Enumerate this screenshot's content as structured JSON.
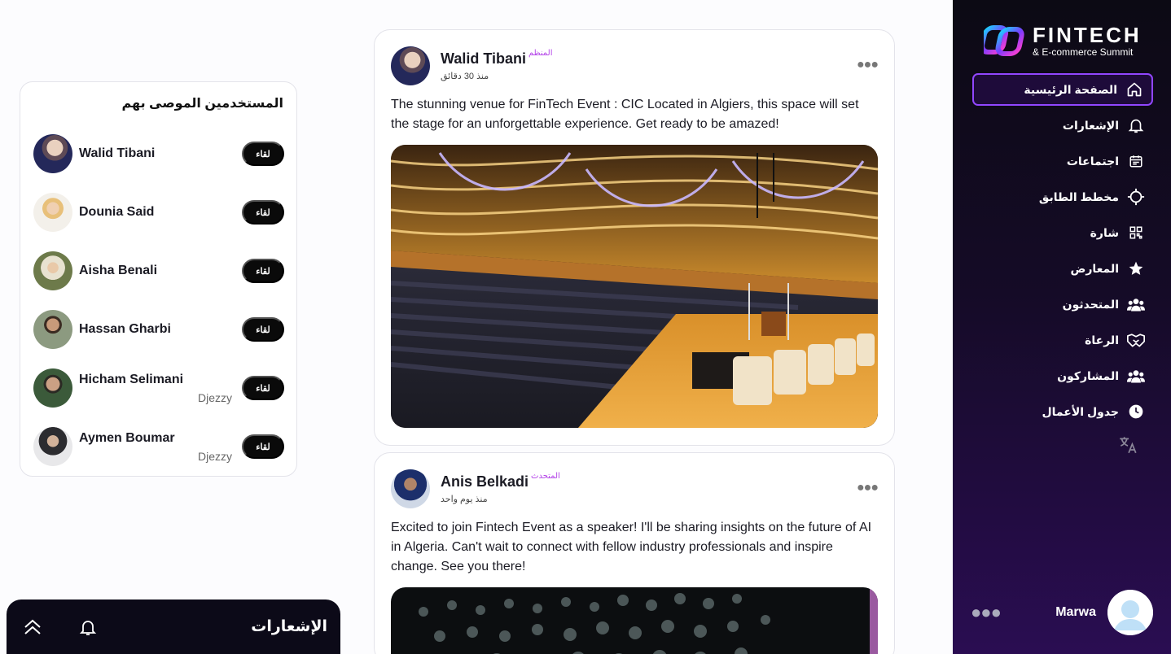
{
  "sidebar": {
    "logo": {
      "title": "FINTECH",
      "subtitle": "& E-commerce Summit"
    },
    "items": [
      {
        "label": "الصفحة الرئيسية",
        "icon": "home-icon",
        "active": true
      },
      {
        "label": "الإشعارات",
        "icon": "bell-icon"
      },
      {
        "label": "اجتماعات",
        "icon": "calendar-icon"
      },
      {
        "label": "مخطط الطابق",
        "icon": "crosshair-icon"
      },
      {
        "label": "شارة",
        "icon": "qr-code-icon"
      },
      {
        "label": "المعارض",
        "icon": "star-icon"
      },
      {
        "label": "المتحدثون",
        "icon": "users-icon"
      },
      {
        "label": "الرعاة",
        "icon": "handshake-icon"
      },
      {
        "label": "المشاركون",
        "icon": "users-icon"
      },
      {
        "label": "جدول الأعمال",
        "icon": "clock-icon"
      }
    ],
    "user": {
      "name": "Marwa"
    }
  },
  "recommended": {
    "title": "المستخدمين الموصى بهم",
    "button_label": "لقاء",
    "users": [
      {
        "name": "Walid Tibani",
        "company": ""
      },
      {
        "name": "Dounia Said",
        "company": ""
      },
      {
        "name": "Aisha Benali",
        "company": ""
      },
      {
        "name": "Hassan Gharbi",
        "company": ""
      },
      {
        "name": "Hicham Selimani",
        "company": "Djezzy"
      },
      {
        "name": "Aymen Boumar",
        "company": "Djezzy"
      }
    ]
  },
  "posts": [
    {
      "author": "Walid Tibani",
      "role": "المنظم",
      "time": "منذ 30 دقائق",
      "text": "The stunning venue for FinTech Event : CIC Located in Algiers, this space will set the stage for an unforgettable experience. Get ready to be amazed!"
    },
    {
      "author": "Anis Belkadi",
      "role": "المتحدث",
      "time": "منذ يوم واحد",
      "text": "Excited to join Fintech Event as a speaker! I'll be sharing insights on the future of AI in Algeria. Can't wait to connect with fellow industry professionals and inspire change. See you there!"
    }
  ],
  "notifications_bar": {
    "title": "الإشعارات"
  },
  "colors": {
    "accent": "#9146ff",
    "role": "#b342e8",
    "sidebar_bg": "#0c0a14"
  }
}
